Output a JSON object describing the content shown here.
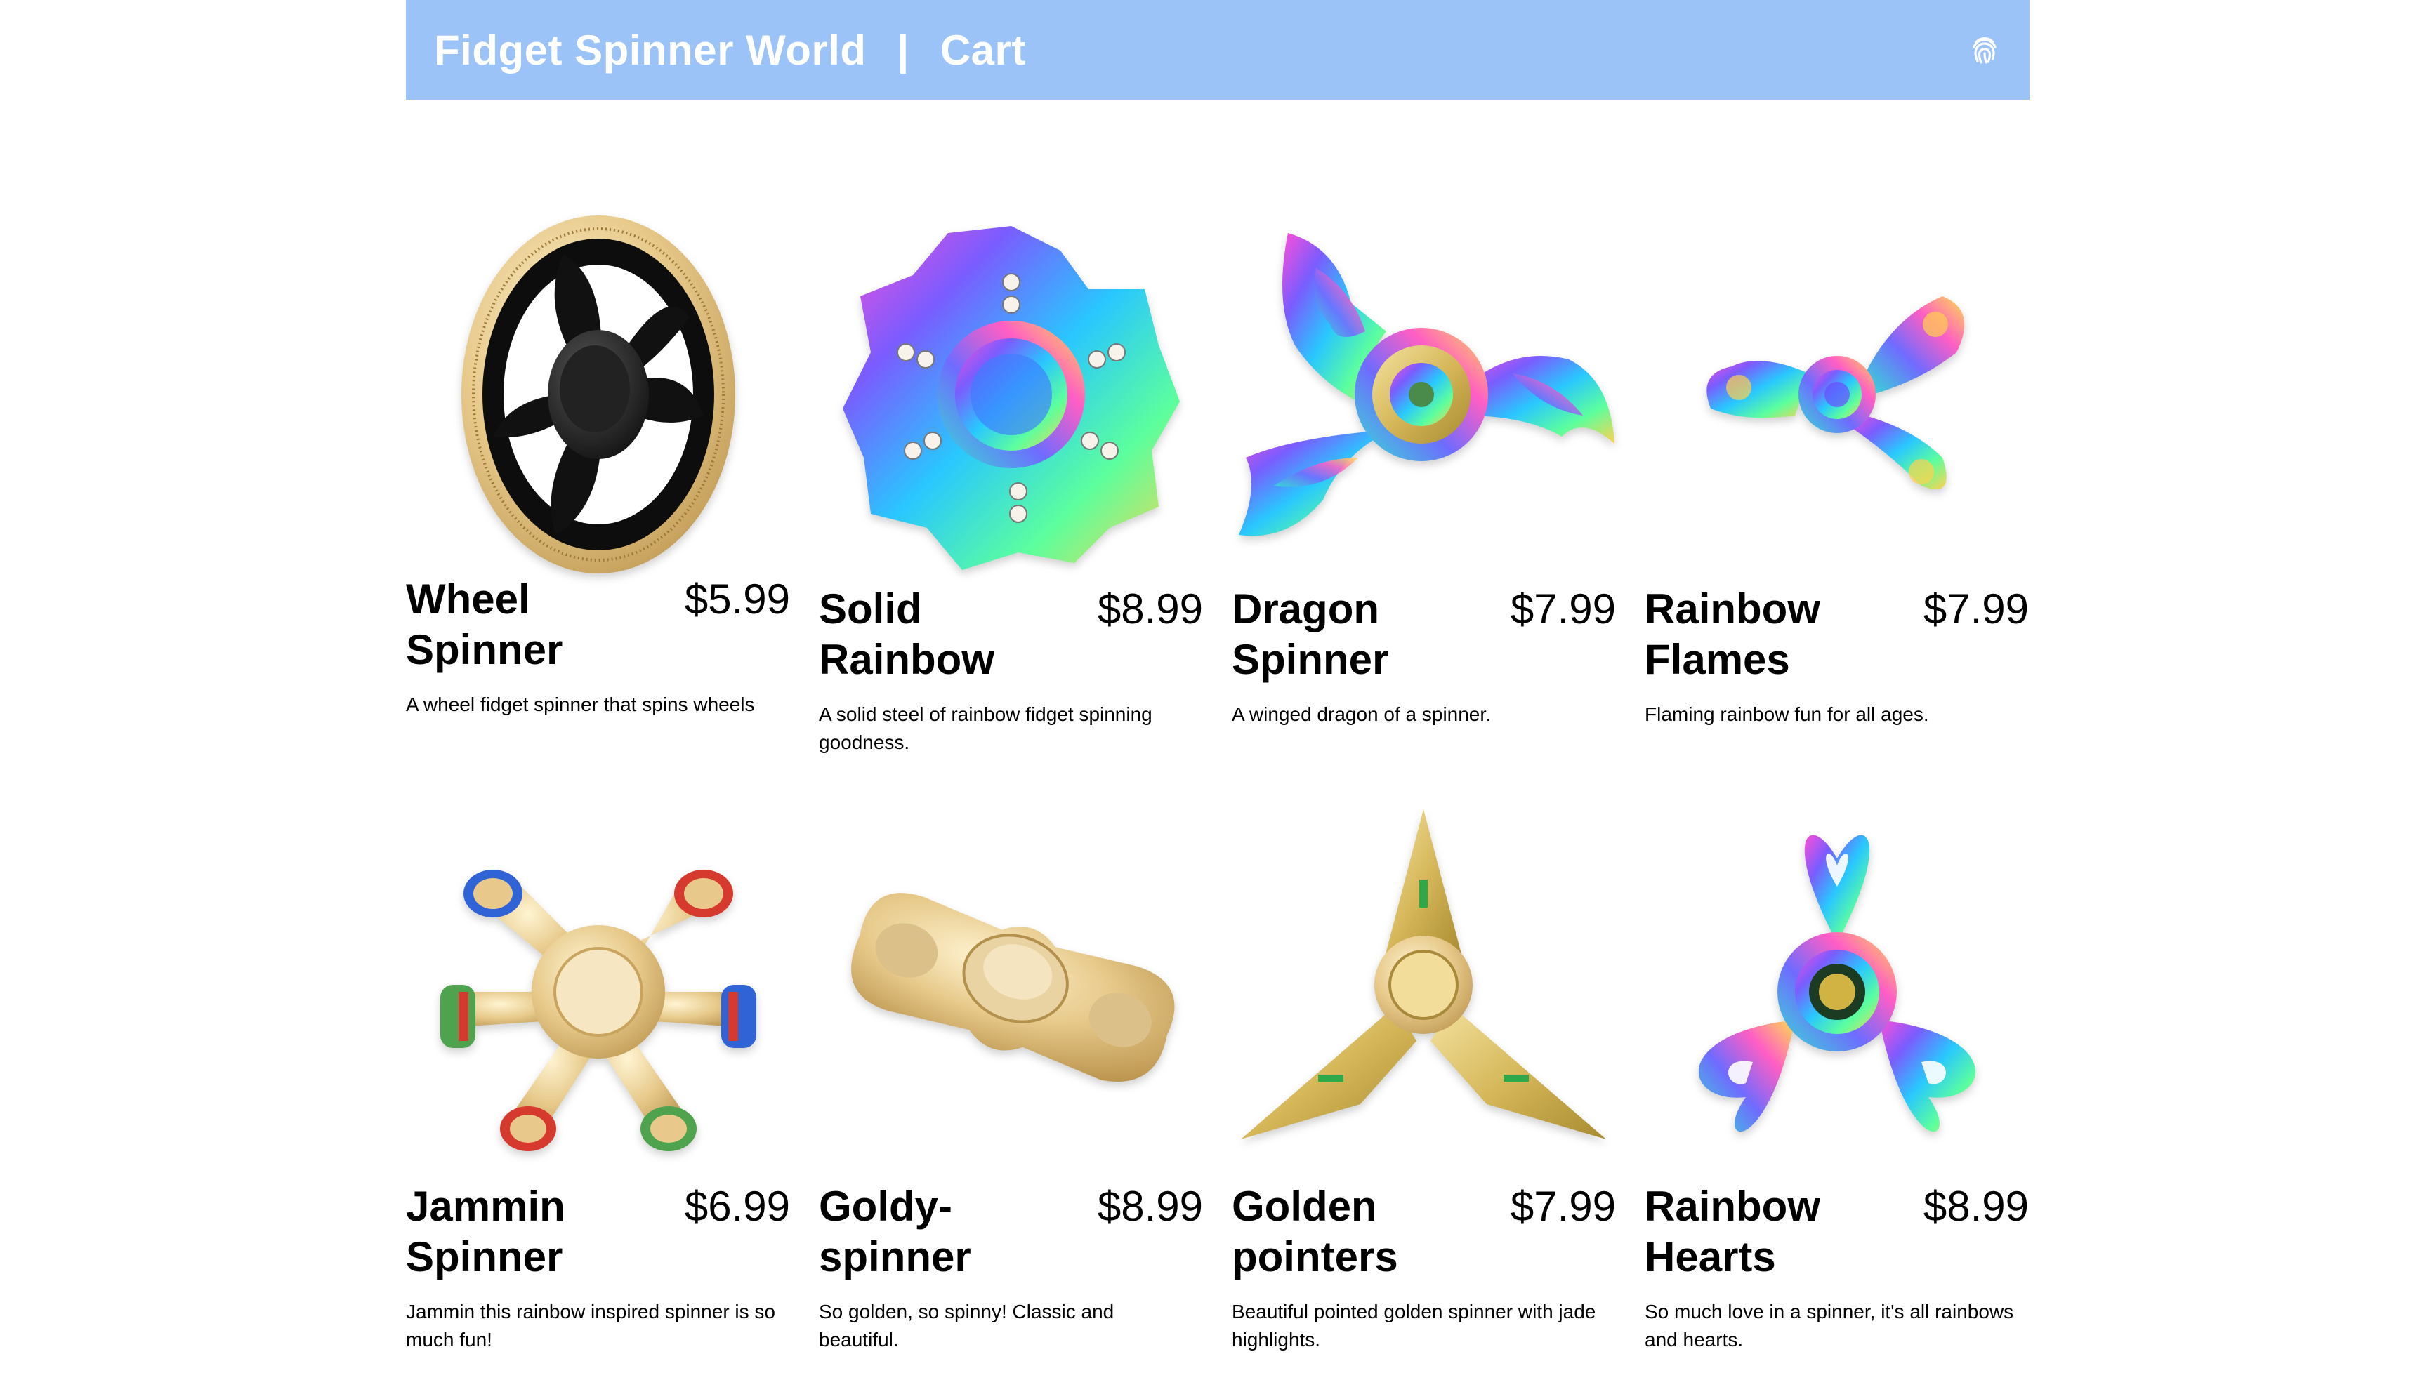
{
  "header": {
    "site_title": "Fidget Spinner World",
    "separator": "|",
    "cart_link": "Cart",
    "icon": "fingerprint-icon",
    "background_color": "#9cc3f7"
  },
  "products": [
    {
      "name": "Wheel Spinner",
      "price": "$5.99",
      "description": "A wheel fidget spinner that spins wheels",
      "image": "wheel-spinner-image"
    },
    {
      "name": "Solid Rainbow",
      "price": "$8.99",
      "description": "A solid steel of rainbow fidget spinning goodness.",
      "image": "solid-rainbow-image"
    },
    {
      "name": "Dragon Spinner",
      "price": "$7.99",
      "description": "A winged dragon of a spinner.",
      "image": "dragon-spinner-image"
    },
    {
      "name": "Rainbow Flames",
      "price": "$7.99",
      "description": "Flaming rainbow fun for all ages.",
      "image": "rainbow-flames-image"
    },
    {
      "name": "Jammin Spinner",
      "price": "$6.99",
      "description": "Jammin this rainbow inspired spinner is so much fun!",
      "image": "jammin-spinner-image"
    },
    {
      "name": "Goldy-spinner",
      "price": "$8.99",
      "description": "So golden, so spinny! Classic and beautiful.",
      "image": "goldy-spinner-image"
    },
    {
      "name": "Golden pointers",
      "price": "$7.99",
      "description": "Beautiful pointed golden spinner with jade highlights.",
      "image": "golden-pointers-image"
    },
    {
      "name": "Rainbow Hearts",
      "price": "$8.99",
      "description": "So much love in a spinner, it's all rainbows and hearts.",
      "image": "rainbow-hearts-image"
    }
  ]
}
